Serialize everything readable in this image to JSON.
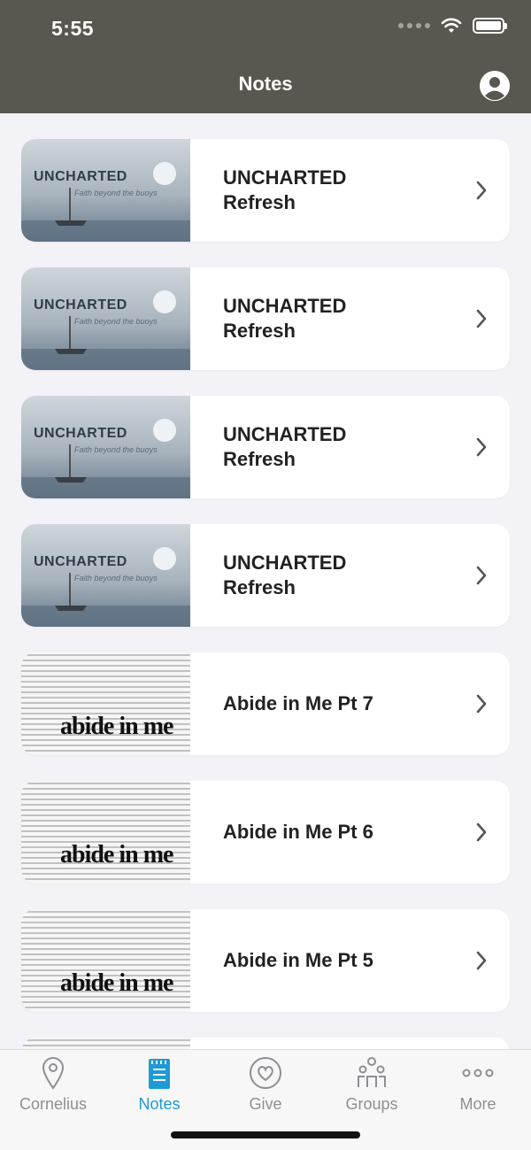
{
  "status_bar": {
    "time": "5:55"
  },
  "header": {
    "title": "Notes"
  },
  "items": [
    {
      "thumb": "uncharted",
      "title": "UNCHARTED\nRefresh",
      "thumb_text": "UNCHARTED",
      "thumb_sub": "Faith beyond the buoys"
    },
    {
      "thumb": "uncharted",
      "title": "UNCHARTED\nRefresh",
      "thumb_text": "UNCHARTED",
      "thumb_sub": "Faith beyond the buoys"
    },
    {
      "thumb": "uncharted",
      "title": "UNCHARTED\nRefresh",
      "thumb_text": "UNCHARTED",
      "thumb_sub": "Faith beyond the buoys"
    },
    {
      "thumb": "uncharted",
      "title": "UNCHARTED\nRefresh",
      "thumb_text": "UNCHARTED",
      "thumb_sub": "Faith beyond the buoys"
    },
    {
      "thumb": "abide",
      "title": "Abide in Me Pt 7",
      "thumb_text": "abide in me"
    },
    {
      "thumb": "abide",
      "title": "Abide in Me Pt 6",
      "thumb_text": "abide in me"
    },
    {
      "thumb": "abide",
      "title": "Abide in Me Pt 5",
      "thumb_text": "abide in me"
    },
    {
      "thumb": "abide",
      "title": "",
      "thumb_text": ""
    }
  ],
  "tabs": [
    {
      "label": "Cornelius",
      "icon": "location-pin-icon",
      "active": false
    },
    {
      "label": "Notes",
      "icon": "notepad-icon",
      "active": true
    },
    {
      "label": "Give",
      "icon": "heart-icon",
      "active": false
    },
    {
      "label": "Groups",
      "icon": "groups-icon",
      "active": false
    },
    {
      "label": "More",
      "icon": "more-dots-icon",
      "active": false
    }
  ],
  "colors": {
    "header_bg": "#5a5650",
    "accent": "#1e9ad6",
    "tab_inactive": "#8e8e93"
  }
}
